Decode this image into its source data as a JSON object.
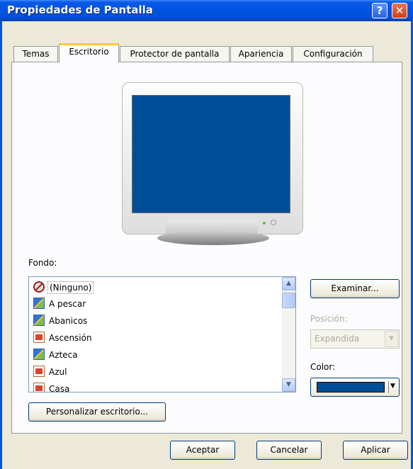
{
  "window": {
    "title": "Propiedades de Pantalla",
    "help_glyph": "?",
    "close_glyph": "✕"
  },
  "tabs": [
    {
      "label": "Temas",
      "active": false
    },
    {
      "label": "Escritorio",
      "active": true
    },
    {
      "label": "Protector de pantalla",
      "active": false
    },
    {
      "label": "Apariencia",
      "active": false
    },
    {
      "label": "Configuración",
      "active": false
    }
  ],
  "desktop": {
    "background_label": "Fondo:",
    "backgrounds": [
      {
        "label": "(Ninguno)",
        "icon": "none-icon",
        "selected": true
      },
      {
        "label": "A pescar",
        "icon": "picture-icon"
      },
      {
        "label": "Abanicos",
        "icon": "picture-icon"
      },
      {
        "label": "Ascensión",
        "icon": "document-picture-icon"
      },
      {
        "label": "Azteca",
        "icon": "picture-icon"
      },
      {
        "label": "Azul",
        "icon": "document-picture-icon"
      },
      {
        "label": "Casa",
        "icon": "document-picture-icon"
      }
    ],
    "browse_label": "Examinar...",
    "position_label": "Posición:",
    "position_value": "Expandida",
    "position_enabled": false,
    "color_label": "Color:",
    "color_value": "#004e98",
    "customize_label": "Personalizar escritorio..."
  },
  "footer": {
    "ok_label": "Aceptar",
    "cancel_label": "Cancelar",
    "apply_label": "Aplicar"
  },
  "colors": {
    "titlebar": "#0054e3",
    "preview_screen": "#004e98",
    "active_tab_highlight": "#ffc83c"
  }
}
